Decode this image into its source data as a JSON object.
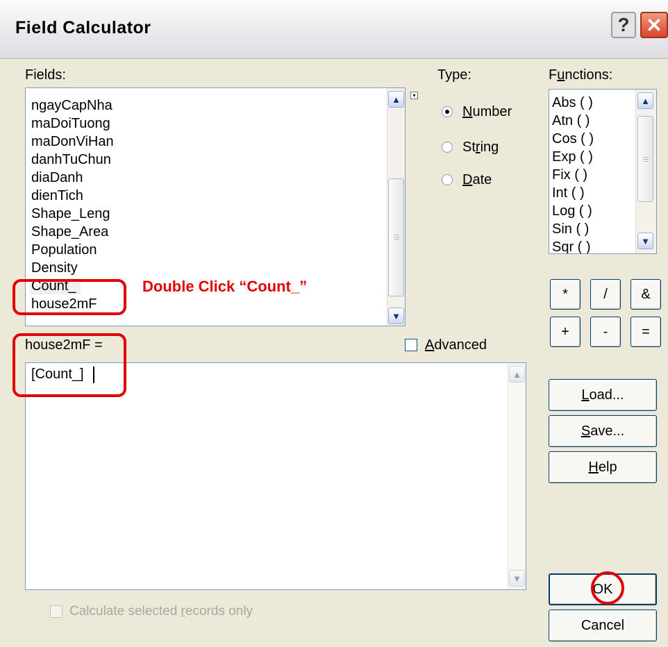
{
  "window": {
    "title": "Field Calculator",
    "help_glyph": "?",
    "close_glyph": "✕"
  },
  "fields": {
    "label": "Fields:",
    "items": [
      "ngayCapNha",
      "maDoiTuong",
      "maDonViHan",
      "danhTuChun",
      "diaDanh",
      "dienTich",
      "Shape_Leng",
      "Shape_Area",
      "Population",
      "Density",
      "Count_",
      "house2mF"
    ],
    "selected": "Count_"
  },
  "type": {
    "label": "Type:",
    "options": [
      {
        "label": "Number",
        "checked": true
      },
      {
        "label": "String",
        "checked": false
      },
      {
        "label": "Date",
        "checked": false
      }
    ]
  },
  "functions": {
    "label": "Functions:",
    "items": [
      "Abs ( )",
      "Atn ( )",
      "Cos ( )",
      "Exp ( )",
      "Fix ( )",
      "Int ( )",
      "Log ( )",
      "Sin ( )",
      "Sqr ( )"
    ]
  },
  "operators": [
    "*",
    "/",
    "&",
    "+",
    "-",
    "="
  ],
  "expression": {
    "label": "house2mF =",
    "value": "[Count_]"
  },
  "advanced": {
    "label": "Advanced",
    "checked": false
  },
  "buttons": {
    "load": "Load...",
    "save": "Save...",
    "help": "Help",
    "ok": "OK",
    "cancel": "Cancel"
  },
  "calc_selected": {
    "label": "Calculate selected records only",
    "checked": false,
    "enabled": false
  },
  "annotation": {
    "text": "Double Click “Count_”",
    "color": "#e30000"
  },
  "colors": {
    "dialog_bg": "#ece9d8",
    "annotation_red": "#e30000",
    "focus_border": "#003c74"
  }
}
